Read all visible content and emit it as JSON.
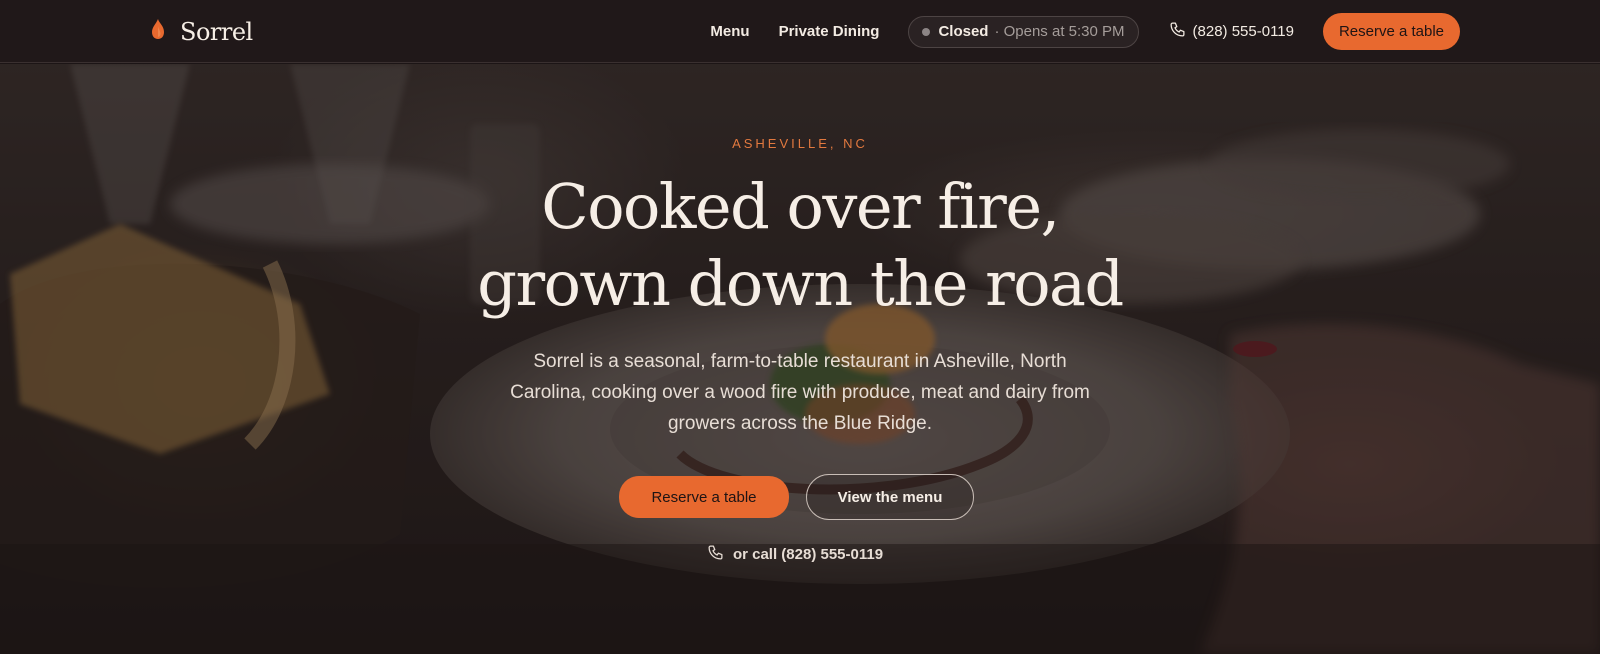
{
  "brand": {
    "name": "Sorrel",
    "logo_icon": "flame-icon",
    "accent_color": "#e8692f"
  },
  "nav": {
    "links": [
      {
        "label": "Menu"
      },
      {
        "label": "Private Dining"
      }
    ],
    "status": {
      "state": "Closed",
      "detail": "· Opens at 5:30 PM"
    },
    "phone": {
      "icon": "phone-icon",
      "number": "(828) 555-0119"
    },
    "cta_label": "Reserve a table"
  },
  "hero": {
    "eyebrow": "ASHEVILLE, NC",
    "headline_line1": "Cooked over fire,",
    "headline_line2": "grown down the road",
    "subtitle": "Sorrel is a seasonal, farm-to-table restaurant in Asheville, North Carolina, cooking over a wood fire with produce, meat and dairy from growers across the Blue Ridge.",
    "primary_cta": "Reserve a table",
    "secondary_cta": "View the menu",
    "call_text": "or call (828) 555-0119"
  }
}
